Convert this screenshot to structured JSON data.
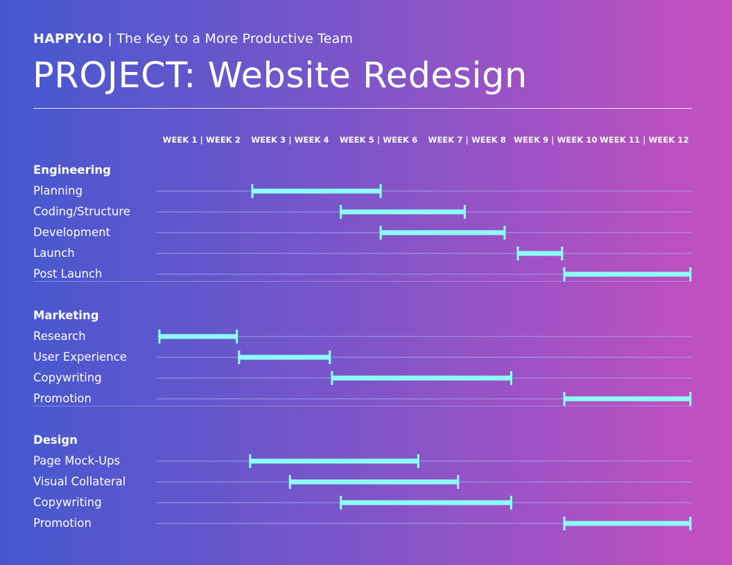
{
  "header": {
    "brand": "HAPPY.IO",
    "separator": " | ",
    "tagline": "The Key to a More Productive Team",
    "title": "PROJECT: Website Redesign"
  },
  "colors": {
    "bar": "#8cfff7",
    "track": "#a9b8ff",
    "background_start": "#4458d0",
    "background_end": "#c64fbf"
  },
  "chart_data": {
    "type": "gantt",
    "title": "PROJECT: Website Redesign",
    "x_unit": "week",
    "xlim": [
      0,
      12
    ],
    "column_labels": [
      "WEEK 1 | WEEK 2",
      "WEEK 3 | WEEK 4",
      "WEEK 5 | WEEK 6",
      "WEEK 7 | WEEK 8",
      "WEEK 9 | WEEK 10",
      "WEEK 11 | WEEK 12"
    ],
    "groups": [
      {
        "name": "Engineering",
        "tasks": [
          {
            "name": "Planning",
            "start": 2.1,
            "end": 5.0
          },
          {
            "name": "Coding/Structure",
            "start": 4.1,
            "end": 6.9
          },
          {
            "name": "Development",
            "start": 5.0,
            "end": 7.8
          },
          {
            "name": "Launch",
            "start": 8.1,
            "end": 9.1
          },
          {
            "name": "Post Launch",
            "start": 9.15,
            "end": 12.0
          }
        ]
      },
      {
        "name": "Marketing",
        "tasks": [
          {
            "name": "Research",
            "start": 0.0,
            "end": 1.75
          },
          {
            "name": "User Experience",
            "start": 1.8,
            "end": 3.85
          },
          {
            "name": "Copywriting",
            "start": 3.9,
            "end": 7.95
          },
          {
            "name": "Promotion",
            "start": 9.15,
            "end": 12.0
          }
        ]
      },
      {
        "name": "Design",
        "tasks": [
          {
            "name": "Page Mock-Ups",
            "start": 2.05,
            "end": 5.85
          },
          {
            "name": "Visual Collateral",
            "start": 2.95,
            "end": 6.75
          },
          {
            "name": "Copywriting",
            "start": 4.1,
            "end": 7.95
          },
          {
            "name": "Promotion",
            "start": 9.15,
            "end": 12.0
          }
        ]
      }
    ]
  }
}
